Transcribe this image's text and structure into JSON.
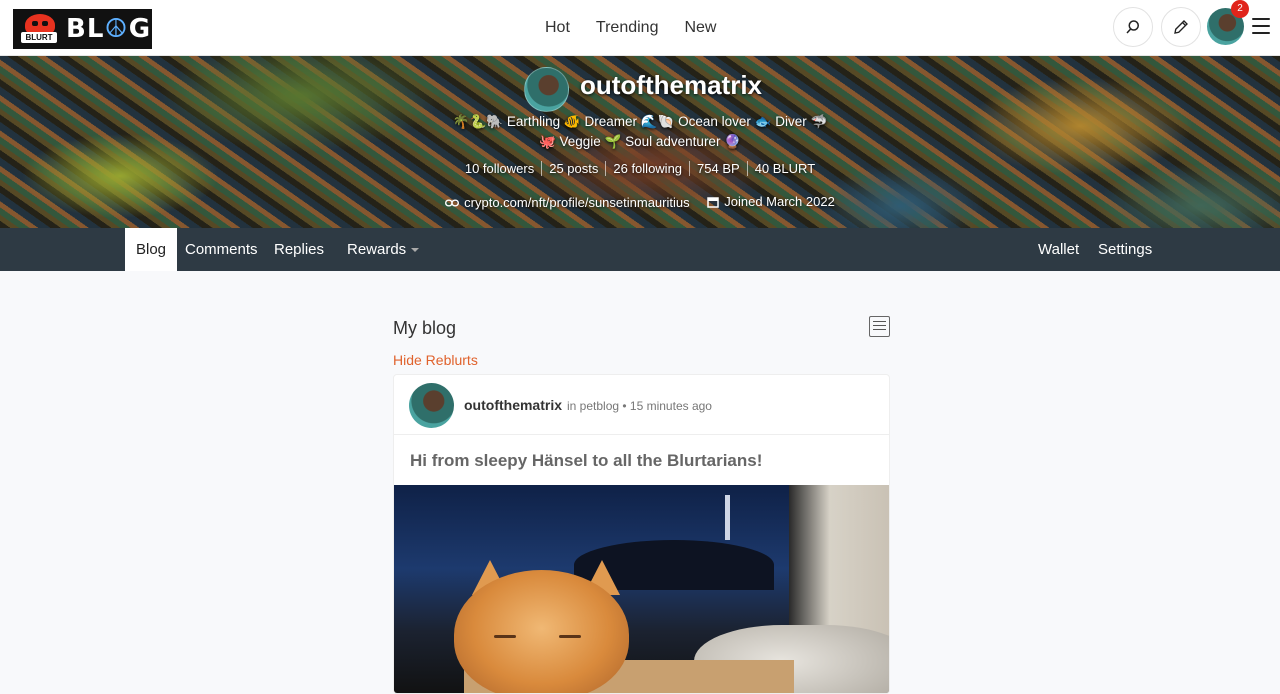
{
  "header": {
    "logo_badge_text": "BLURT",
    "logo_text_left": "BL",
    "logo_text_peace": "☮",
    "logo_text_right": "G",
    "nav": [
      "Hot",
      "Trending",
      "New"
    ],
    "notification_count": "2"
  },
  "profile": {
    "name": "outofthematrix",
    "about_line1": "🌴🐍🐘 Earthling 🐠 Dreamer 🌊🐚 Ocean lover 🐟 Diver 🦈",
    "about_line2": "🐙 Veggie 🌱 Soul adventurer 🔮",
    "stats": [
      "10 followers",
      "25 posts",
      "26 following",
      "754 BP",
      "40 BLURT"
    ],
    "website": "crypto.com/nft/profile/sunsetinmauritius",
    "joined": "Joined March 2022"
  },
  "profile_nav": {
    "left": [
      "Blog",
      "Comments",
      "Replies",
      "Rewards"
    ],
    "right": [
      "Wallet",
      "Settings"
    ],
    "active": "Blog"
  },
  "content": {
    "heading": "My blog",
    "hide_reblurts": "Hide Reblurts"
  },
  "post": {
    "author": "outofthematrix",
    "meta": "in petblog • 15 minutes ago",
    "title": "Hi from sleepy Hänsel to all the Blurtarians!"
  }
}
